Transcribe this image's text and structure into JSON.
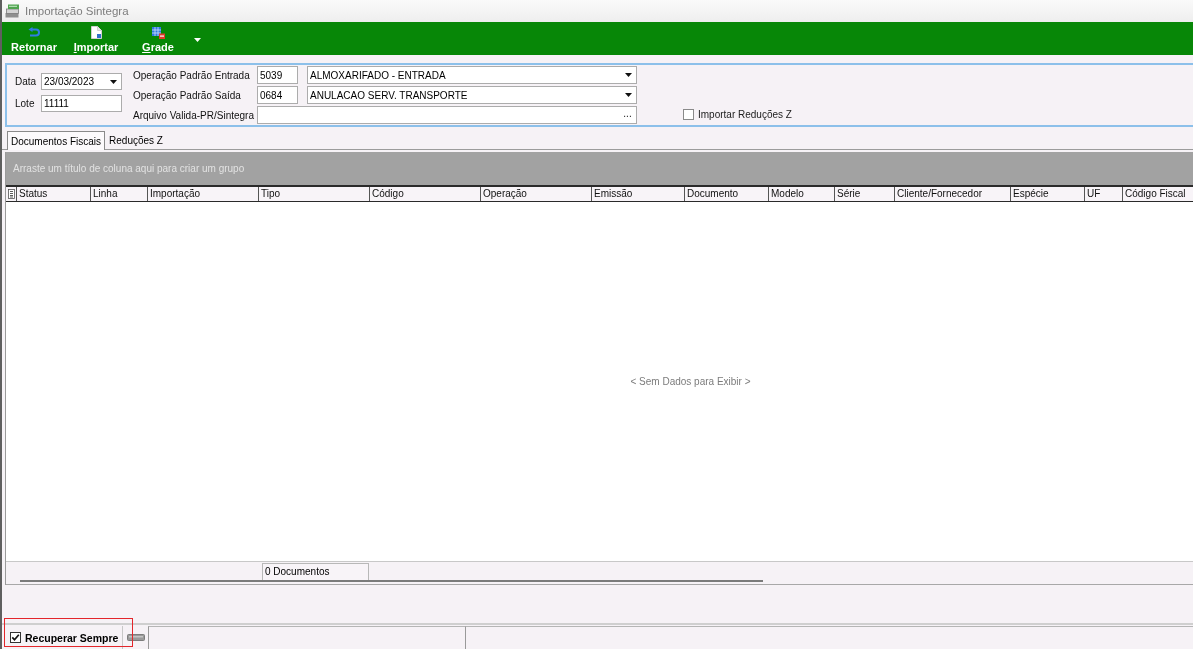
{
  "window": {
    "title": "Importação Sintegra"
  },
  "toolbar": {
    "buttons": [
      {
        "label": "Retornar",
        "kind": "return",
        "mnemonic": false
      },
      {
        "label": "Importar",
        "kind": "document",
        "mnemonic": true
      },
      {
        "label": "Grade",
        "kind": "grid",
        "mnemonic": true
      }
    ]
  },
  "form": {
    "date": {
      "label": "Data",
      "value": "23/03/2023"
    },
    "lot": {
      "label": "Lote",
      "value": "11111"
    },
    "operations": [
      {
        "label": "Operação Padrão Entrada",
        "code": "5039",
        "value": "ALMOXARIFADO - ENTRADA"
      },
      {
        "label": "Operação Padrão Saída",
        "code": "0684",
        "value": "ANULACAO SERV. TRANSPORTE"
      }
    ],
    "file": {
      "label": "Arquivo Valida-PR/Sintegra",
      "button": "..."
    },
    "import_z": {
      "label": "Importar Reduções Z",
      "checked": false
    }
  },
  "tabs": [
    {
      "label": "Documentos Fiscais",
      "selected": true
    },
    {
      "label": "Reduções Z",
      "selected": false
    }
  ],
  "grid": {
    "group_hint": "Arraste um título de coluna aqui para criar um grupo",
    "columns": [
      "Status",
      "Linha",
      "Importação",
      "Tipo",
      "Código",
      "Operação",
      "Emissão",
      "Documento",
      "Modelo",
      "Série",
      "Cliente/Fornecedor",
      "Espécie",
      "UF",
      "Código Fiscal"
    ],
    "empty_text": "< Sem Dados para Exibir >",
    "summary": "0 Documentos"
  },
  "status_bar": {
    "recover": {
      "label": "Recuperar Sempre",
      "checked": true,
      "highlighted": true
    }
  }
}
